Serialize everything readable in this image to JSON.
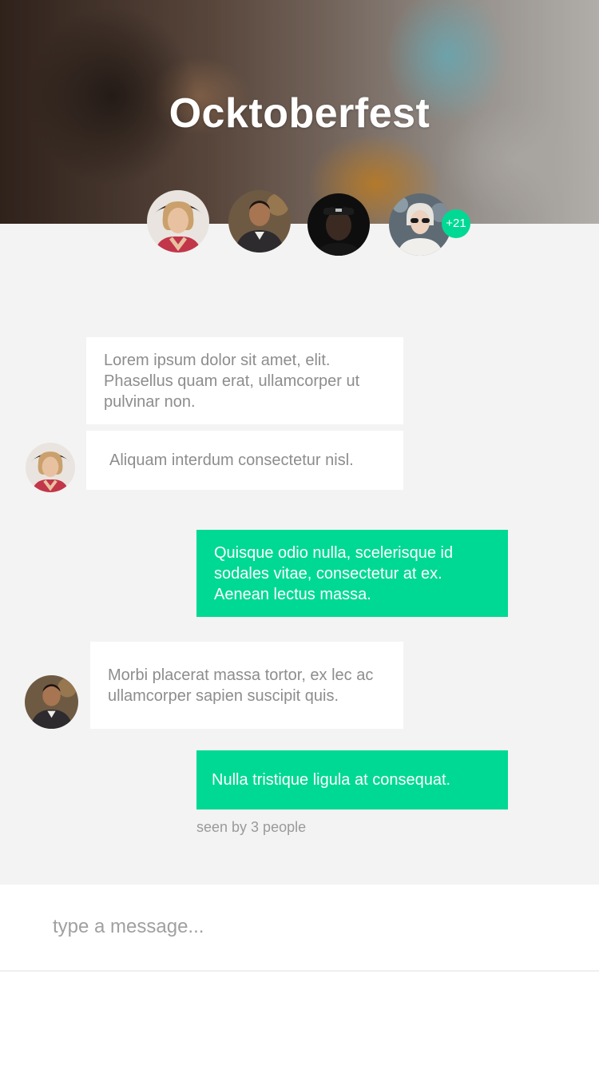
{
  "header": {
    "title": "Ocktoberfest"
  },
  "participants": {
    "avatars": [
      {
        "name": "woman-with-hat",
        "accent": "#c2364a"
      },
      {
        "name": "smiling-man",
        "accent": "#5b3a2e"
      },
      {
        "name": "man-with-cap",
        "accent": "#1a1a1a"
      },
      {
        "name": "woman-with-sunglasses",
        "accent": "#9fa8b2"
      }
    ],
    "more_count": "+21"
  },
  "messages": [
    {
      "direction": "in",
      "text": "Lorem ipsum dolor sit amet, elit. Phasellus quam erat, ullamcorper ut pulvinar non."
    },
    {
      "direction": "in",
      "text": "Aliquam interdum consectetur nisl."
    },
    {
      "direction": "out",
      "text": "Quisque odio nulla, scelerisque id sodales vitae, consectetur at ex. Aenean lectus massa."
    },
    {
      "direction": "in",
      "text": "Morbi placerat massa tortor, ex lec ac ullamcorper sapien suscipit quis."
    },
    {
      "direction": "out",
      "text": "Nulla tristique ligula at consequat."
    }
  ],
  "seen_text": "seen by 3 people",
  "composer": {
    "placeholder": "type a message..."
  },
  "colors": {
    "accent": "#00d993",
    "chat_bg": "#f3f3f3",
    "incoming_text": "#8d8d8d"
  }
}
